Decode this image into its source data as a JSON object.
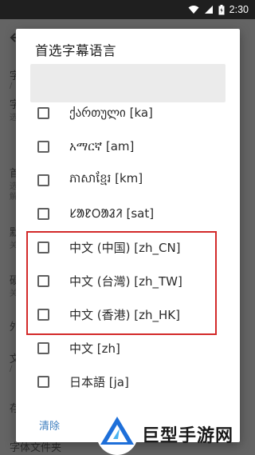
{
  "status_bar": {
    "time": "2:30",
    "icons": [
      "wifi-icon",
      "signal-icon",
      "battery-charging-icon"
    ]
  },
  "background_page": {
    "back_icon": "back-arrow-icon",
    "edge_fragments": [
      "字",
      "/",
      "字",
      "选",
      "首",
      "选",
      "解",
      "默",
      "关",
      "硬",
      "关",
      "外",
      "文",
      "/",
      "存",
      "字体文件夹"
    ]
  },
  "dialog": {
    "title": "首选字幕语言",
    "search": {
      "value": "",
      "placeholder": ""
    },
    "items": [
      {
        "label": "ქართული [ka]",
        "checked": false
      },
      {
        "label": "አማርኛ [am]",
        "checked": false
      },
      {
        "label": "ភាសាខ្មែរ [km]",
        "checked": false
      },
      {
        "label": "ᱥᱟᱱᱛᱟᱲᱤ [sat]",
        "checked": false
      },
      {
        "label": "中文 (中国) [zh_CN]",
        "checked": false
      },
      {
        "label": "中文 (台灣) [zh_TW]",
        "checked": false
      },
      {
        "label": "中文 (香港) [zh_HK]",
        "checked": false
      },
      {
        "label": "中文 [zh]",
        "checked": false
      },
      {
        "label": "日本語 [ja]",
        "checked": false
      }
    ],
    "clear_label": "清除"
  },
  "annotation": {
    "color": "#d32a2a"
  },
  "watermark": {
    "text": "巨型手游网"
  },
  "colors": {
    "accent": "#3f7fbf",
    "highlight": "#d32a2a",
    "scrim": "#646464"
  }
}
